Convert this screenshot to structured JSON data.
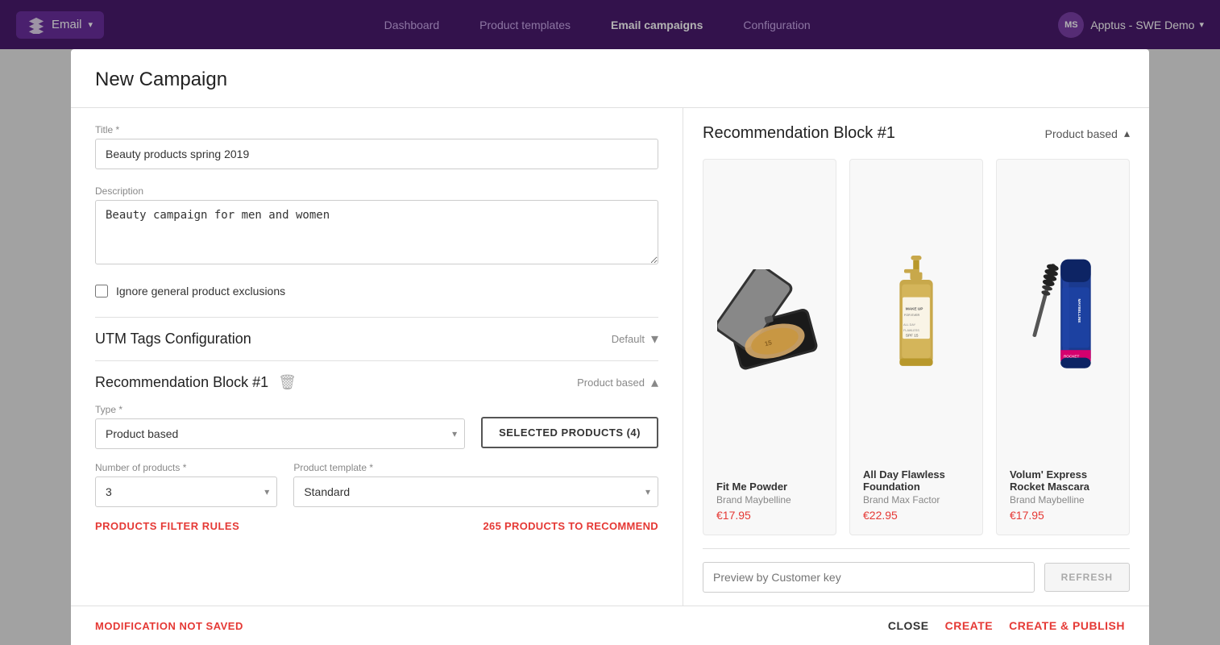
{
  "nav": {
    "brand_label": "Email",
    "links": [
      {
        "label": "Dashboard",
        "active": false
      },
      {
        "label": "Product templates",
        "active": false
      },
      {
        "label": "Email campaigns",
        "active": true
      },
      {
        "label": "Configuration",
        "active": false
      }
    ],
    "user_initials": "MS",
    "user_name": "Apptus - SWE Demo"
  },
  "modal": {
    "title": "New Campaign",
    "form": {
      "title_label": "Title *",
      "title_value": "Beauty products spring 2019",
      "description_label": "Description",
      "description_value": "Beauty campaign for men and women",
      "checkbox_label": "Ignore general product exclusions",
      "utm_section_title": "UTM Tags Configuration",
      "utm_badge": "Default",
      "rec_block_title": "Recommendation Block #1",
      "rec_block_badge": "Product based",
      "type_label": "Type *",
      "type_value": "Product based",
      "selected_products_btn": "SELECTED PRODUCTS (4)",
      "num_products_label": "Number of products *",
      "num_products_value": "3",
      "product_template_label": "Product template *",
      "product_template_value": "Standard",
      "filter_rules_link": "PRODUCTS FILTER RULES",
      "products_count": "265 PRODUCTS TO RECOMMEND"
    },
    "right_panel": {
      "title": "Recommendation Block #1",
      "badge": "Product based",
      "products": [
        {
          "name": "Fit Me Powder",
          "brand": "Brand Maybelline",
          "price": "€17.95"
        },
        {
          "name": "All Day Flawless Foundation",
          "brand": "Brand Max Factor",
          "price": "€22.95"
        },
        {
          "name": "Volum' Express Rocket Mascara",
          "brand": "Brand Maybelline",
          "price": "€17.95"
        }
      ],
      "preview_placeholder": "Preview by Customer key",
      "refresh_btn": "REFRESH"
    },
    "footer": {
      "not_saved": "MODIFICATION NOT SAVED",
      "close_btn": "CLOSE",
      "create_btn": "CREATE",
      "create_publish_btn": "CREATE & PUBLISH"
    }
  }
}
